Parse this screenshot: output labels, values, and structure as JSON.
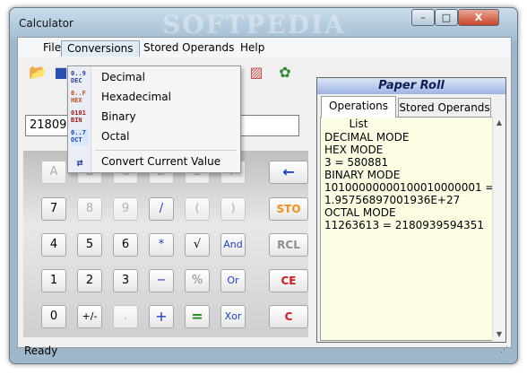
{
  "window": {
    "title": "Calculator",
    "watermark": "SOFTPEDIA"
  },
  "window_controls": {
    "minimize": "–",
    "maximize": "□",
    "close": "X"
  },
  "menu": [
    {
      "label": "File"
    },
    {
      "label": "Conversions"
    },
    {
      "label": "Stored Operands"
    },
    {
      "label": "Help"
    }
  ],
  "toolbar_icons": [
    "open-folder-icon",
    "save-icon",
    "print-icon",
    "settings-icon"
  ],
  "dropdown": {
    "items": [
      {
        "label": "Decimal",
        "icon": "0..9 DEC"
      },
      {
        "label": "Hexadecimal",
        "icon": "0..F HEX"
      },
      {
        "label": "Binary",
        "icon": "0101 BIN"
      },
      {
        "label": "Octal",
        "icon": "0..7 OCT"
      }
    ],
    "convert": {
      "label": "Convert Current Value",
      "icon": "convert"
    }
  },
  "display": {
    "value": "21809"
  },
  "keypad": {
    "rows": [
      [
        "A",
        "B",
        "C",
        "D",
        "E",
        "F"
      ],
      [
        "7",
        "8",
        "9",
        "/",
        "(",
        ")"
      ],
      [
        "4",
        "5",
        "6",
        "*",
        "√",
        "And"
      ],
      [
        "1",
        "2",
        "3",
        "−",
        "%",
        "Or"
      ],
      [
        "0",
        "+/-",
        ".",
        "+",
        "=",
        "Xor"
      ]
    ],
    "side": [
      "←",
      "STO",
      "RCL",
      "CE",
      "C"
    ]
  },
  "paper_roll": {
    "title": "Paper Roll",
    "tabs": [
      "Operations List",
      "Stored Operands"
    ],
    "lines": [
      "DECIMAL MODE",
      "",
      "HEX MODE",
      "3 = 580881",
      "",
      "BINARY MODE",
      "10100000000100010000001 =",
      "1.95756897001936E+27",
      "",
      "OCTAL MODE",
      "11263613 = 2180939594351"
    ]
  },
  "status": {
    "text": "Ready"
  }
}
